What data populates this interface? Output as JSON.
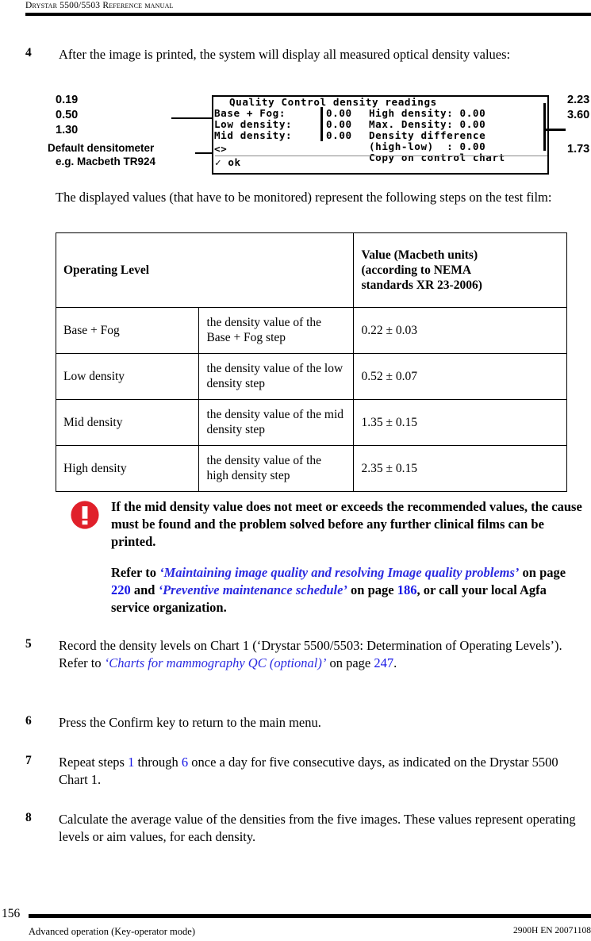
{
  "header": {
    "title": "Drystar 5500/5503 Reference manual"
  },
  "steps": {
    "s4": {
      "num": "4",
      "text": "After the image is printed, the system will display all measured optical density values:"
    },
    "intro_paragraph": "The displayed values (that have to be monitored) represent the following steps on the test film:",
    "s5": {
      "num": "5",
      "part1": "Record the density levels on Chart 1 (‘Drystar 5500/5503: Determination of Operating Levels’). Refer to ",
      "link": "‘Charts for mammography QC (optional)’",
      "part2": " on page ",
      "page": "247",
      "part3": "."
    },
    "s6": {
      "num": "6",
      "text": "Press the Confirm key to return to the main menu."
    },
    "s7": {
      "num": "7",
      "part1": "Repeat steps ",
      "ref1": "1",
      "part2": " through ",
      "ref2": "6",
      "part3": " once a day for five consecutive days, as indicated on the Drystar 5500 Chart 1."
    },
    "s8": {
      "num": "8",
      "text": "Calculate the average value of the densities from the five images. These values represent operating levels or aim values, for each density."
    }
  },
  "lcd": {
    "title": "Quality Control density readings",
    "row1_left": "Base + Fog:",
    "row1_left_val": "0.00",
    "row2_left": "Low density:",
    "row2_left_val": "0.00",
    "row3_left": "Mid density:",
    "row3_left_val": "0.00",
    "row1_right": "High density: 0.00",
    "row2_right": "Max. Density: 0.00",
    "row3_right": "Density difference",
    "row4_right": "(high-low)  : 0.00",
    "row5_right": "Copy on control chart",
    "nav": "<>",
    "ok": "✓ ok"
  },
  "callouts": {
    "left_values": [
      "0.19",
      "0.50",
      "1.30"
    ],
    "left_note_line1": "Default densitometer",
    "left_note_line2": "e.g. Macbeth TR924",
    "right_values": [
      "2.23",
      "3.60",
      "1.73"
    ]
  },
  "table": {
    "headers": {
      "operating_level": "Operating Level",
      "value": "Value (Macbeth units) (according to NEMA standards XR 23-2006)",
      "value_l1": "Value (Macbeth units)",
      "value_l2": "(according to NEMA",
      "value_l3": "standards XR 23-2006)"
    },
    "rows": [
      {
        "level": "Base + Fog",
        "description": "the density value of the Base + Fog step",
        "value": "0.22 ± 0.03"
      },
      {
        "level": "Low density",
        "description": "the density value of the low density step",
        "value": "0.52 ± 0.07"
      },
      {
        "level": "Mid density",
        "description": "the density value of the mid density step",
        "value": "1.35 ± 0.15"
      },
      {
        "level": "High density",
        "description": "the density value of the high density step",
        "value": "2.35 ± 0.15"
      }
    ]
  },
  "note": {
    "icon": "warning-exclamation-icon",
    "icon_color": "#e0202a",
    "paragraph1": "If the mid density value does not meet or exceeds the recommended values, the cause must be found and the problem solved before any further clinical films can be printed.",
    "p2_part1": "Refer to ",
    "p2_link1": "‘Maintaining image quality and resolving Image quality problems’",
    "p2_part2": " on page ",
    "p2_page1": "220",
    "p2_part3": " and ",
    "p2_link2": "‘Preventive maintenance schedule’",
    "p2_part4": " on page ",
    "p2_page2": "186",
    "p2_part5": ", or call your local Agfa service organization."
  },
  "footer": {
    "page_number": "156",
    "left": "Advanced operation (Key-operator mode)",
    "right": "2900H EN 20071108"
  }
}
